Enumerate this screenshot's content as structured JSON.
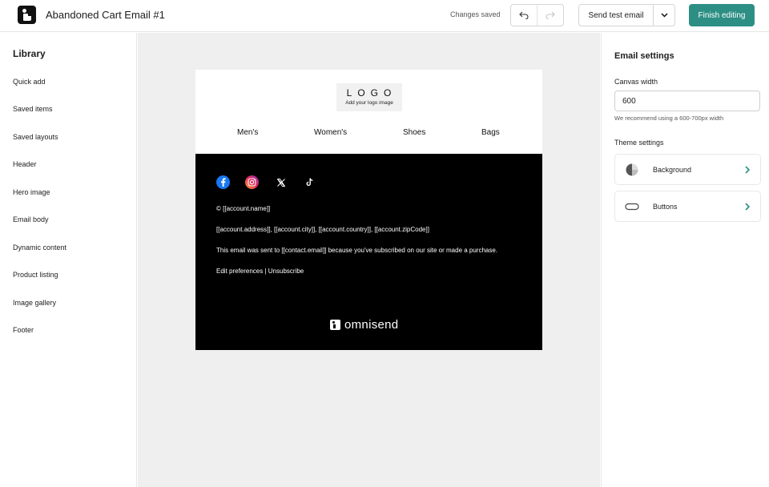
{
  "topbar": {
    "title": "Abandoned Cart Email #1",
    "status": "Changes saved",
    "send_test_label": "Send test email",
    "finish_label": "Finish editing"
  },
  "sidebar": {
    "title": "Library",
    "items": [
      {
        "label": "Quick add"
      },
      {
        "label": "Saved items"
      },
      {
        "label": "Saved layouts"
      },
      {
        "label": "Header"
      },
      {
        "label": "Hero image"
      },
      {
        "label": "Email body"
      },
      {
        "label": "Dynamic content"
      },
      {
        "label": "Product listing"
      },
      {
        "label": "Image gallery"
      },
      {
        "label": "Footer"
      }
    ]
  },
  "email": {
    "logo_text": "LOGO",
    "logo_subtext": "Add your logo image",
    "nav": [
      "Men's",
      "Women's",
      "Shoes",
      "Bags"
    ],
    "footer": {
      "copyright": "© [[account.name]]",
      "address": "[[account.address]], [[account.city]], [[account.country]], [[account.zipCode]]",
      "notice": "This email was sent to [[contact.email]] because you've subscribed on our site or made a purchase.",
      "links": "Edit preferences | Unsubscribe",
      "brand": "omnisend"
    }
  },
  "settings": {
    "title": "Email settings",
    "canvas_width_label": "Canvas width",
    "canvas_width_value": "600",
    "canvas_width_hint": "We recommend using a 600-700px width",
    "theme_title": "Theme settings",
    "theme_items": [
      {
        "label": "Background"
      },
      {
        "label": "Buttons"
      }
    ]
  },
  "colors": {
    "accent": "#2d8f84",
    "canvas_bg": "#efeff0",
    "footer_bg": "#000000",
    "chevron": "#2d8f84"
  }
}
